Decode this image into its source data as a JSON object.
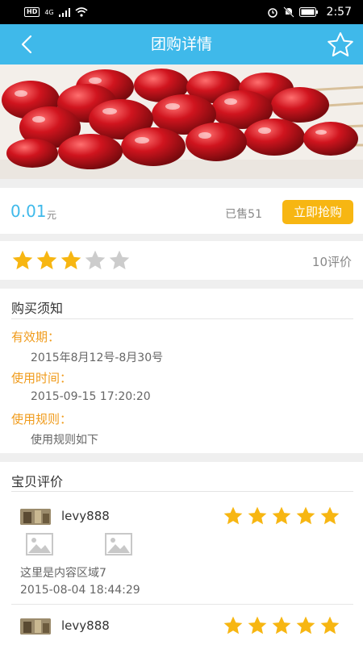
{
  "status_bar": {
    "left_badges": [
      "HD",
      "4G"
    ],
    "time": "2:57"
  },
  "header": {
    "title": "团购详情",
    "back_icon": "back-chevron-icon",
    "fav_icon": "star-outline-icon"
  },
  "deal": {
    "price": "0.01",
    "price_unit": "元",
    "sold": "已售51",
    "buy_label": "立即抢购",
    "rating": 3,
    "rating_max": 5,
    "review_count": "10评价"
  },
  "notice": {
    "title": "购买须知",
    "validity_label": "有效期：",
    "validity_value": "2015年8月12号-8月30号",
    "time_label": "使用时间：",
    "time_value": "2015-09-15 17:20:20",
    "rules_label": "使用规则：",
    "rules_value": "使用规则如下"
  },
  "reviews": {
    "title": "宝贝评价",
    "items": [
      {
        "username": "levy888",
        "stars": 5,
        "text": "这里是内容区域7",
        "time": "2015-08-04 18:44:29"
      },
      {
        "username": "levy888",
        "stars": 5
      }
    ]
  },
  "colors": {
    "accent": "#3fb9ea",
    "star_on": "#f7b612",
    "star_off": "#cccccc",
    "label_orange": "#f09b1b"
  }
}
